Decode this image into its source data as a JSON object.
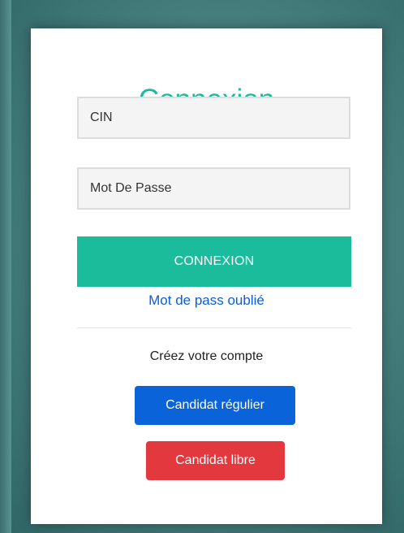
{
  "login": {
    "title": "Connexion",
    "cin_placeholder": "CIN",
    "password_placeholder": "Mot De Passe",
    "submit_label": "CONNEXION",
    "forgot_link": "Mot de pass oublié"
  },
  "signup": {
    "heading": "Créez votre compte",
    "regular_button": "Candidat régulier",
    "free_button": "Candidat libre"
  },
  "colors": {
    "accent": "#1abc9c",
    "link": "#0b5ed7",
    "primary_button": "#0a63d8",
    "danger_button": "#e4383f"
  }
}
